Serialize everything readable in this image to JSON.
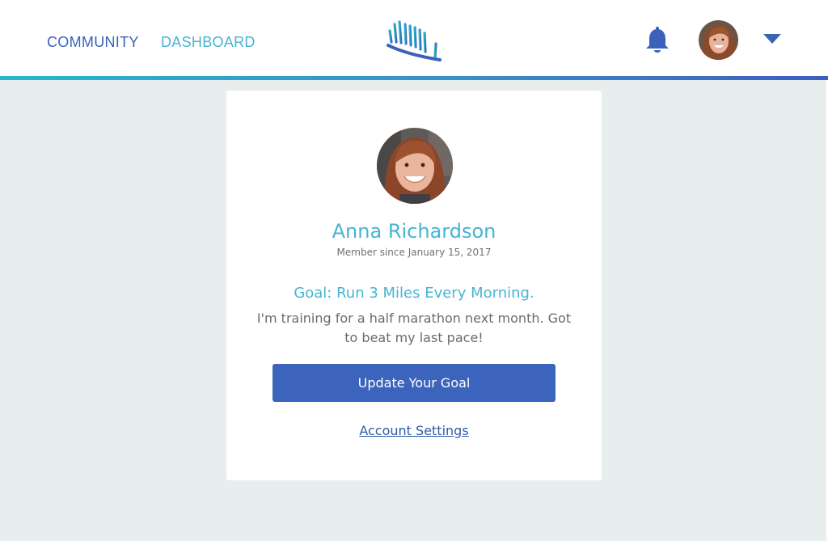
{
  "nav": {
    "community_label": "COMMUNITY",
    "dashboard_label": "DASHBOARD"
  },
  "header": {
    "logo_icon": "shoe-footprint-logo-icon",
    "notification_icon": "bell-icon",
    "menu_icon": "caret-down-icon"
  },
  "profile": {
    "name": "Anna Richardson",
    "member_since": "Member since January 15, 2017",
    "goal_title": "Goal: Run 3 Miles Every Morning.",
    "goal_description": "I'm training for a half marathon next month. Got to beat my last pace!",
    "update_goal_label": "Update Your Goal",
    "account_settings_label": "Account Settings"
  },
  "colors": {
    "accent_teal": "#46b4d3",
    "brand_blue": "#3c64bc",
    "background": "#e8eeee"
  }
}
